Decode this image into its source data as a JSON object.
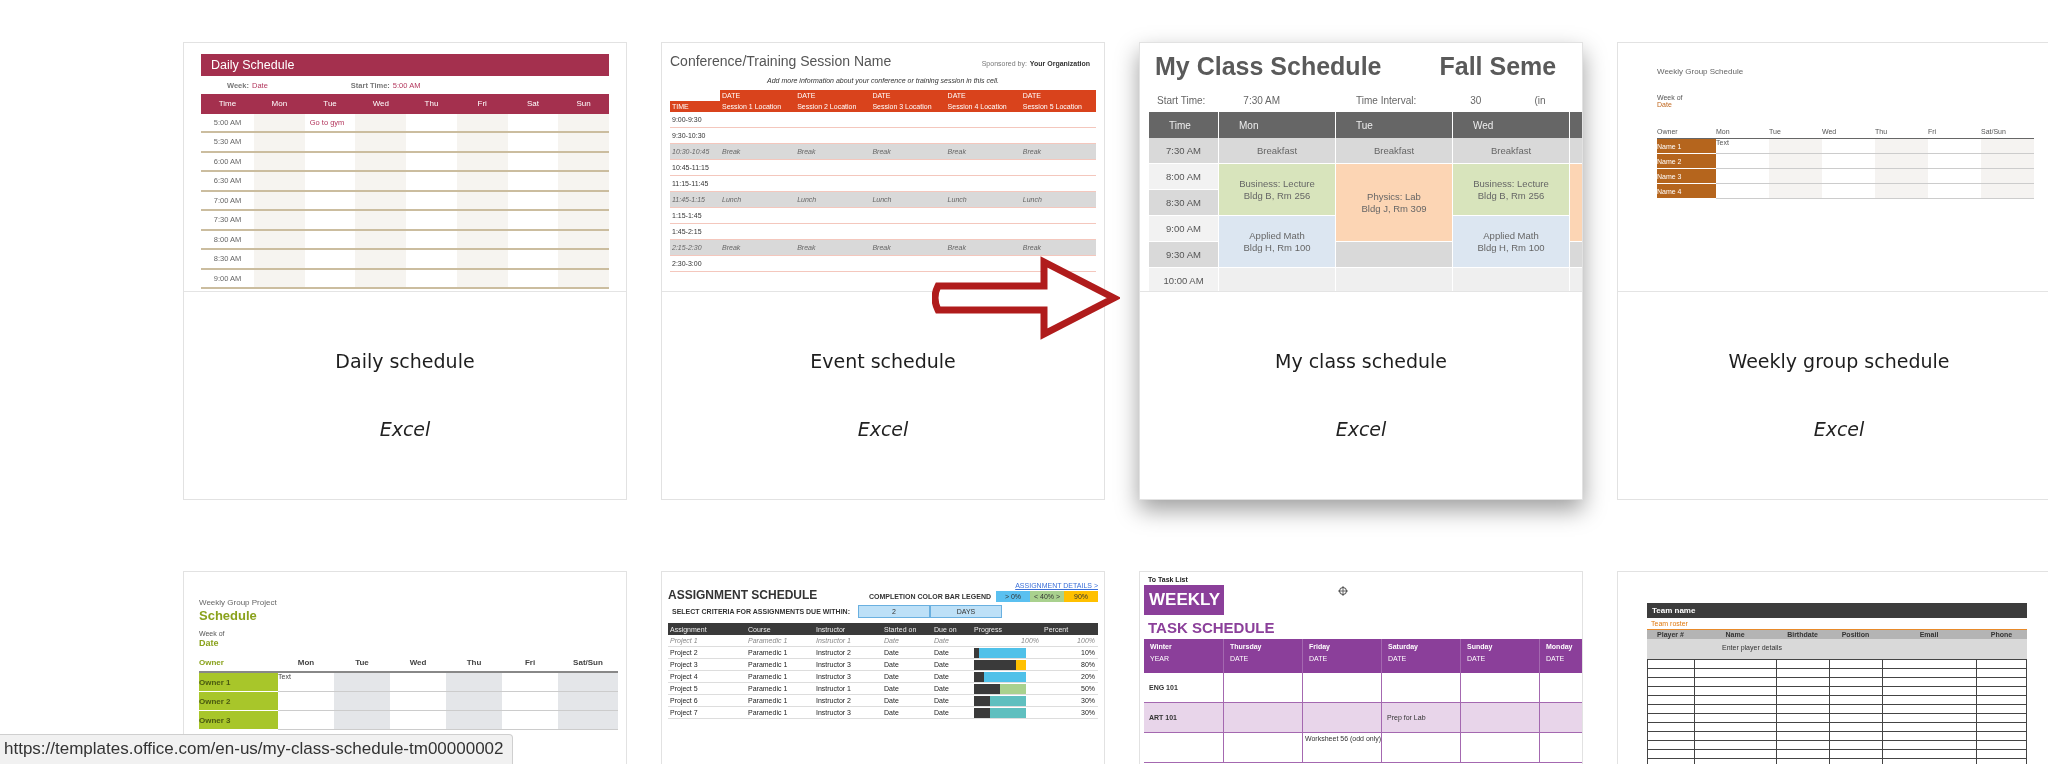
{
  "cards": [
    {
      "title": "Daily schedule",
      "app": "Excel",
      "hovered": false,
      "thumb": {
        "kind": "daily",
        "title": "Daily Schedule",
        "week_label": "Week:",
        "week": "Date",
        "start_label": "Start Time:",
        "start": "5:00 AM",
        "columns": [
          "Time",
          "Mon",
          "Tue",
          "Wed",
          "Thu",
          "Fri",
          "Sat",
          "Sun"
        ],
        "times": [
          "5:00 AM",
          "5:30 AM",
          "6:00 AM",
          "6:30 AM",
          "7:00 AM",
          "7:30 AM",
          "8:00 AM",
          "8:30 AM",
          "9:00 AM"
        ],
        "entry": "Go to gym"
      }
    },
    {
      "title": "Event schedule",
      "app": "Excel",
      "hovered": false,
      "thumb": {
        "kind": "event",
        "title": "Conference/Training Session Name",
        "sponsor_label": "Sponsored by:",
        "sponsor": "Your Organization",
        "info": "Add more information about your conference or training session in this cell.",
        "dates": [
          "DATE",
          "DATE",
          "DATE",
          "DATE",
          "DATE"
        ],
        "time_label": "TIME",
        "sessions": [
          "Session 1 Location",
          "Session 2 Location",
          "Session 3 Location",
          "Session 4 Location",
          "Session 5 Location"
        ],
        "rows": [
          {
            "time": "9:00-9:30",
            "shaded": false
          },
          {
            "time": "9:30-10:30",
            "shaded": false
          },
          {
            "time": "10:30-10:45",
            "shaded": true,
            "entries": [
              "Break",
              "Break",
              "Break",
              "Break",
              "Break"
            ]
          },
          {
            "time": "10:45-11:15",
            "shaded": false
          },
          {
            "time": "11:15-11:45",
            "shaded": false
          },
          {
            "time": "11:45-1:15",
            "shaded": true,
            "entries": [
              "Lunch",
              "Lunch",
              "Lunch",
              "Lunch",
              "Lunch"
            ]
          },
          {
            "time": "1:15-1:45",
            "shaded": false
          },
          {
            "time": "1:45-2:15",
            "shaded": false
          },
          {
            "time": "2:15-2:30",
            "shaded": true,
            "entries": [
              "Break",
              "Break",
              "Break",
              "Break",
              "Break"
            ]
          },
          {
            "time": "2:30-3:00",
            "shaded": false
          }
        ]
      }
    },
    {
      "title": "My class schedule",
      "app": "Excel",
      "hovered": true,
      "thumb": {
        "kind": "class",
        "title": "My Class Schedule",
        "term": "Fall Seme",
        "start_label": "Start Time:",
        "start": "7:30 AM",
        "interval_label": "Time Interval:",
        "interval": "30",
        "unit": "(in",
        "header": [
          "Time",
          "Mon",
          "Tue",
          "Wed"
        ],
        "times": [
          "7:30 AM",
          "8:00 AM",
          "8:30 AM",
          "9:00 AM",
          "9:30 AM",
          "10:00 AM"
        ],
        "days": [
          {
            "blocks": [
              {
                "kind": "meal",
                "color": "#d9d9d9",
                "lines": [
                  "Breakfast"
                ]
              },
              {
                "kind": "lecture",
                "color": "#d8e4bc",
                "lines": [
                  "Business: Lecture",
                  "Bldg B, Rm 256"
                ]
              },
              {
                "kind": "math",
                "color": "#dce6f1",
                "lines": [
                  "Applied Math",
                  "Bldg H, Rm 100"
                ]
              },
              {
                "kind": "free",
                "color": "#efefef"
              }
            ]
          },
          {
            "blocks": [
              {
                "kind": "meal",
                "color": "#d9d9d9",
                "lines": [
                  "Breakfast"
                ]
              },
              {
                "kind": "lab",
                "color": "#fcd5b4",
                "lines": [
                  "Physics: Lab",
                  "Bldg J, Rm 309"
                ]
              },
              {
                "kind": "free",
                "color": "#d9d9d9"
              },
              {
                "kind": "free",
                "color": "#efefef"
              }
            ]
          },
          {
            "blocks": [
              {
                "kind": "meal",
                "color": "#d9d9d9",
                "lines": [
                  "Breakfast"
                ]
              },
              {
                "kind": "lecture",
                "color": "#d8e4bc",
                "lines": [
                  "Business: Lecture",
                  "Bldg B, Rm 256"
                ]
              },
              {
                "kind": "math",
                "color": "#dce6f1",
                "lines": [
                  "Applied Math",
                  "Bldg H, Rm 100"
                ]
              },
              {
                "kind": "free",
                "color": "#efefef"
              }
            ]
          },
          {
            "blocks": [
              {
                "kind": "meal",
                "color": "#d9d9d9"
              },
              {
                "kind": "lab",
                "color": "#fcd5b4"
              },
              {
                "kind": "free",
                "color": "#d9d9d9"
              },
              {
                "kind": "free",
                "color": "#efefef"
              }
            ]
          }
        ]
      }
    },
    {
      "title": "Weekly group schedule",
      "app": "Excel",
      "hovered": false,
      "thumb": {
        "kind": "group",
        "title": "Weekly Group Schedule",
        "week_label": "Week of",
        "week": "Date",
        "owner_label": "Owner",
        "days": [
          "Mon",
          "Tue",
          "Wed",
          "Thu",
          "Fri",
          "Sat/Sun"
        ],
        "names": [
          "Name 1",
          "Name 2",
          "Name 3",
          "Name 4"
        ],
        "entry": "Text"
      }
    },
    {
      "hovered": false,
      "thumb": {
        "kind": "project",
        "title": "Weekly Group Project",
        "subtitle": "Schedule",
        "week_label": "Week of",
        "week": "Date",
        "owner_label": "Owner",
        "days": [
          "Mon",
          "Tue",
          "Wed",
          "Thu",
          "Fri",
          "Sat/Sun"
        ],
        "names": [
          "Owner 1",
          "Owner 2",
          "Owner 3"
        ],
        "entry": "Text"
      }
    },
    {
      "hovered": false,
      "thumb": {
        "kind": "assignment",
        "title": "ASSIGNMENT SCHEDULE",
        "details_link": "ASSIGNMENT DETAILS >",
        "legend_label": "COMPLETION COLOR BAR LEGEND",
        "legend": [
          {
            "text": "> 0%",
            "color": "#5bc0f0"
          },
          {
            "text": "< 40% >",
            "color": "#a9d18e"
          },
          {
            "text": "90%",
            "color": "#ffc000"
          }
        ],
        "criteria_label": "SELECT CRITERIA FOR ASSIGNMENTS DUE WITHIN:",
        "criteria_value": "2",
        "criteria_unit": "DAYS",
        "columns": [
          "Assignment",
          "Course",
          "Instructor",
          "Started on",
          "Due on",
          "Progress",
          "Percent"
        ],
        "rows": [
          {
            "kind": "sample",
            "cells": [
              "Project 1",
              "Paramedic 1",
              "Instructor 1",
              "Date",
              "Date"
            ],
            "progress": "100%",
            "percent": "100%"
          },
          {
            "kind": "bar",
            "cells": [
              "Project 2",
              "Paramedic 1",
              "Instructor 2",
              "Date",
              "Date"
            ],
            "level": 0.1,
            "color": "#4fc1e9",
            "percent": "10%"
          },
          {
            "kind": "bar",
            "cells": [
              "Project 3",
              "Paramedic 1",
              "Instructor 3",
              "Date",
              "Date"
            ],
            "level": 0.8,
            "color": "#ffc000",
            "percent": "80%"
          },
          {
            "kind": "bar",
            "cells": [
              "Project 4",
              "Paramedic 1",
              "Instructor 3",
              "Date",
              "Date"
            ],
            "level": 0.2,
            "color": "#4fc1e9",
            "percent": "20%"
          },
          {
            "kind": "bar",
            "cells": [
              "Project 5",
              "Paramedic 1",
              "Instructor 1",
              "Date",
              "Date"
            ],
            "level": 0.5,
            "color": "#a9d18e",
            "percent": "50%"
          },
          {
            "kind": "bar",
            "cells": [
              "Project 6",
              "Paramedic 1",
              "Instructor 2",
              "Date",
              "Date"
            ],
            "level": 0.3,
            "color": "#5fbfbf",
            "percent": "30%"
          },
          {
            "kind": "bar",
            "cells": [
              "Project 7",
              "Paramedic 1",
              "Instructor 3",
              "Date",
              "Date"
            ],
            "level": 0.3,
            "color": "#5fbfbf",
            "percent": "30%"
          }
        ]
      }
    },
    {
      "hovered": false,
      "thumb": {
        "kind": "task",
        "back_link": "To Task List",
        "badge": "WEEKLY",
        "title": "TASK SCHEDULE",
        "columns": [
          {
            "name": "Winter",
            "sub": "YEAR"
          },
          {
            "name": "Thursday",
            "sub": "DATE"
          },
          {
            "name": "Friday",
            "sub": "DATE"
          },
          {
            "name": "Saturday",
            "sub": "DATE"
          },
          {
            "name": "Sunday",
            "sub": "DATE"
          },
          {
            "name": "Monday",
            "sub": "DATE"
          }
        ],
        "rows": [
          {
            "shaded": false,
            "cells": [
              {
                "text": "ENG 101"
              },
              {},
              {},
              {},
              {},
              {}
            ]
          },
          {
            "shaded": true,
            "cells": [
              {
                "text": "ART 101"
              },
              {},
              {},
              {
                "text": "Prep for Lab"
              },
              {},
              {}
            ]
          },
          {
            "shaded": false,
            "cells": [
              {},
              {},
              {
                "text": "Worksheet 56 (odd only)"
              },
              {},
              {},
              {}
            ]
          }
        ]
      }
    },
    {
      "hovered": false,
      "thumb": {
        "kind": "roster",
        "title": "Team name",
        "subtitle": "Team roster",
        "columns": [
          "Player #",
          "Name",
          "Birthdate",
          "Position",
          "Email",
          "Phone"
        ],
        "hint": "Enter player details"
      }
    }
  ],
  "status_bar": {
    "url": "https://templates.office.com/en-us/my-class-schedule-tm00000002"
  }
}
